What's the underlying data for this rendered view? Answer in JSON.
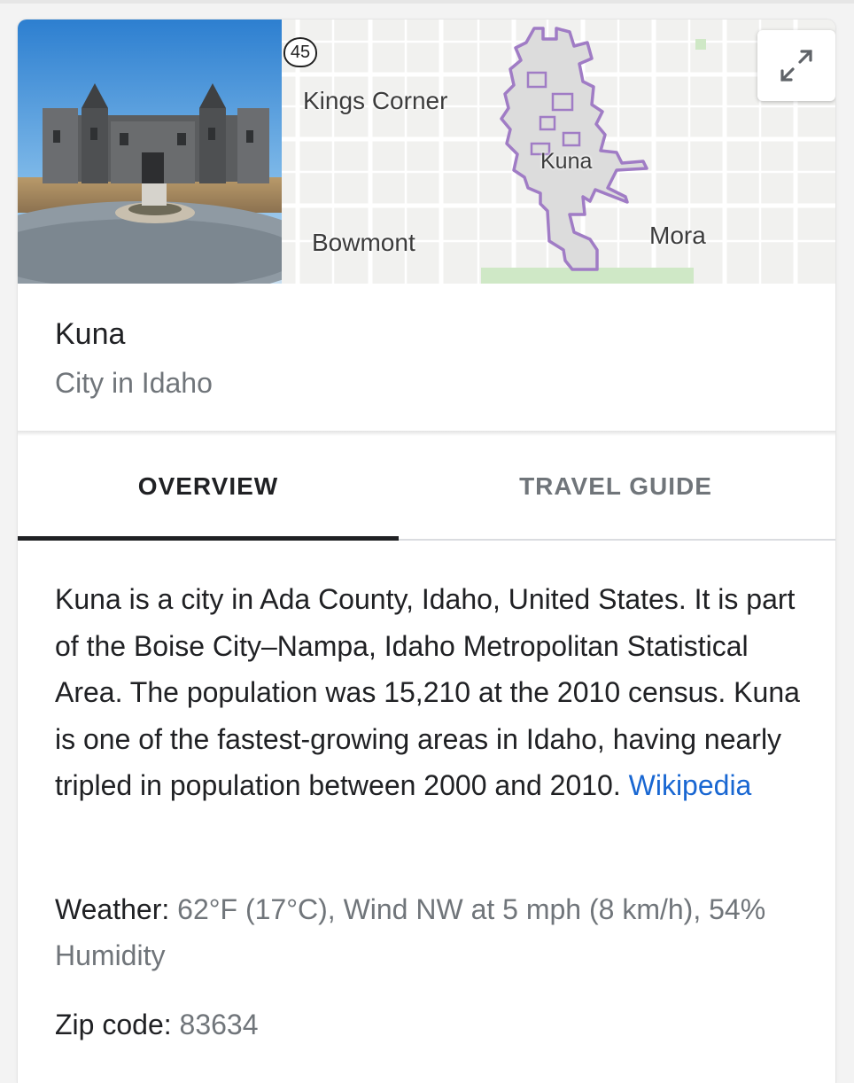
{
  "map": {
    "route_number": "45",
    "labels": {
      "kings_corner": "Kings Corner",
      "kuna": "Kuna",
      "bowmont": "Bowmont",
      "mora": "Mora"
    }
  },
  "entity": {
    "title": "Kuna",
    "subtitle": "City in Idaho"
  },
  "tabs": [
    {
      "label": "OVERVIEW",
      "selected": true
    },
    {
      "label": "TRAVEL GUIDE",
      "selected": false
    }
  ],
  "overview": {
    "description": "Kuna is a city in Ada County, Idaho, United States. It is part of the Boise City–Nampa, Idaho Metropolitan Statistical Area. The population was 15,210 at the 2010 census. Kuna is one of the fastest-growing areas in Idaho, having nearly tripled in population between 2000 and 2010.",
    "source_link": "Wikipedia"
  },
  "facts": {
    "weather_label": "Weather:",
    "weather_value": "62°F (17°C), Wind NW at 5 mph (8 km/h), 54% Humidity",
    "zip_label": "Zip code:",
    "zip_value": "83634"
  },
  "colors": {
    "link": "#1967d2",
    "boundary": "#a07cc5",
    "tab_active": "#202124",
    "tab_inactive": "#70757a"
  },
  "icons": {
    "expand": "expand-arrows-icon"
  }
}
